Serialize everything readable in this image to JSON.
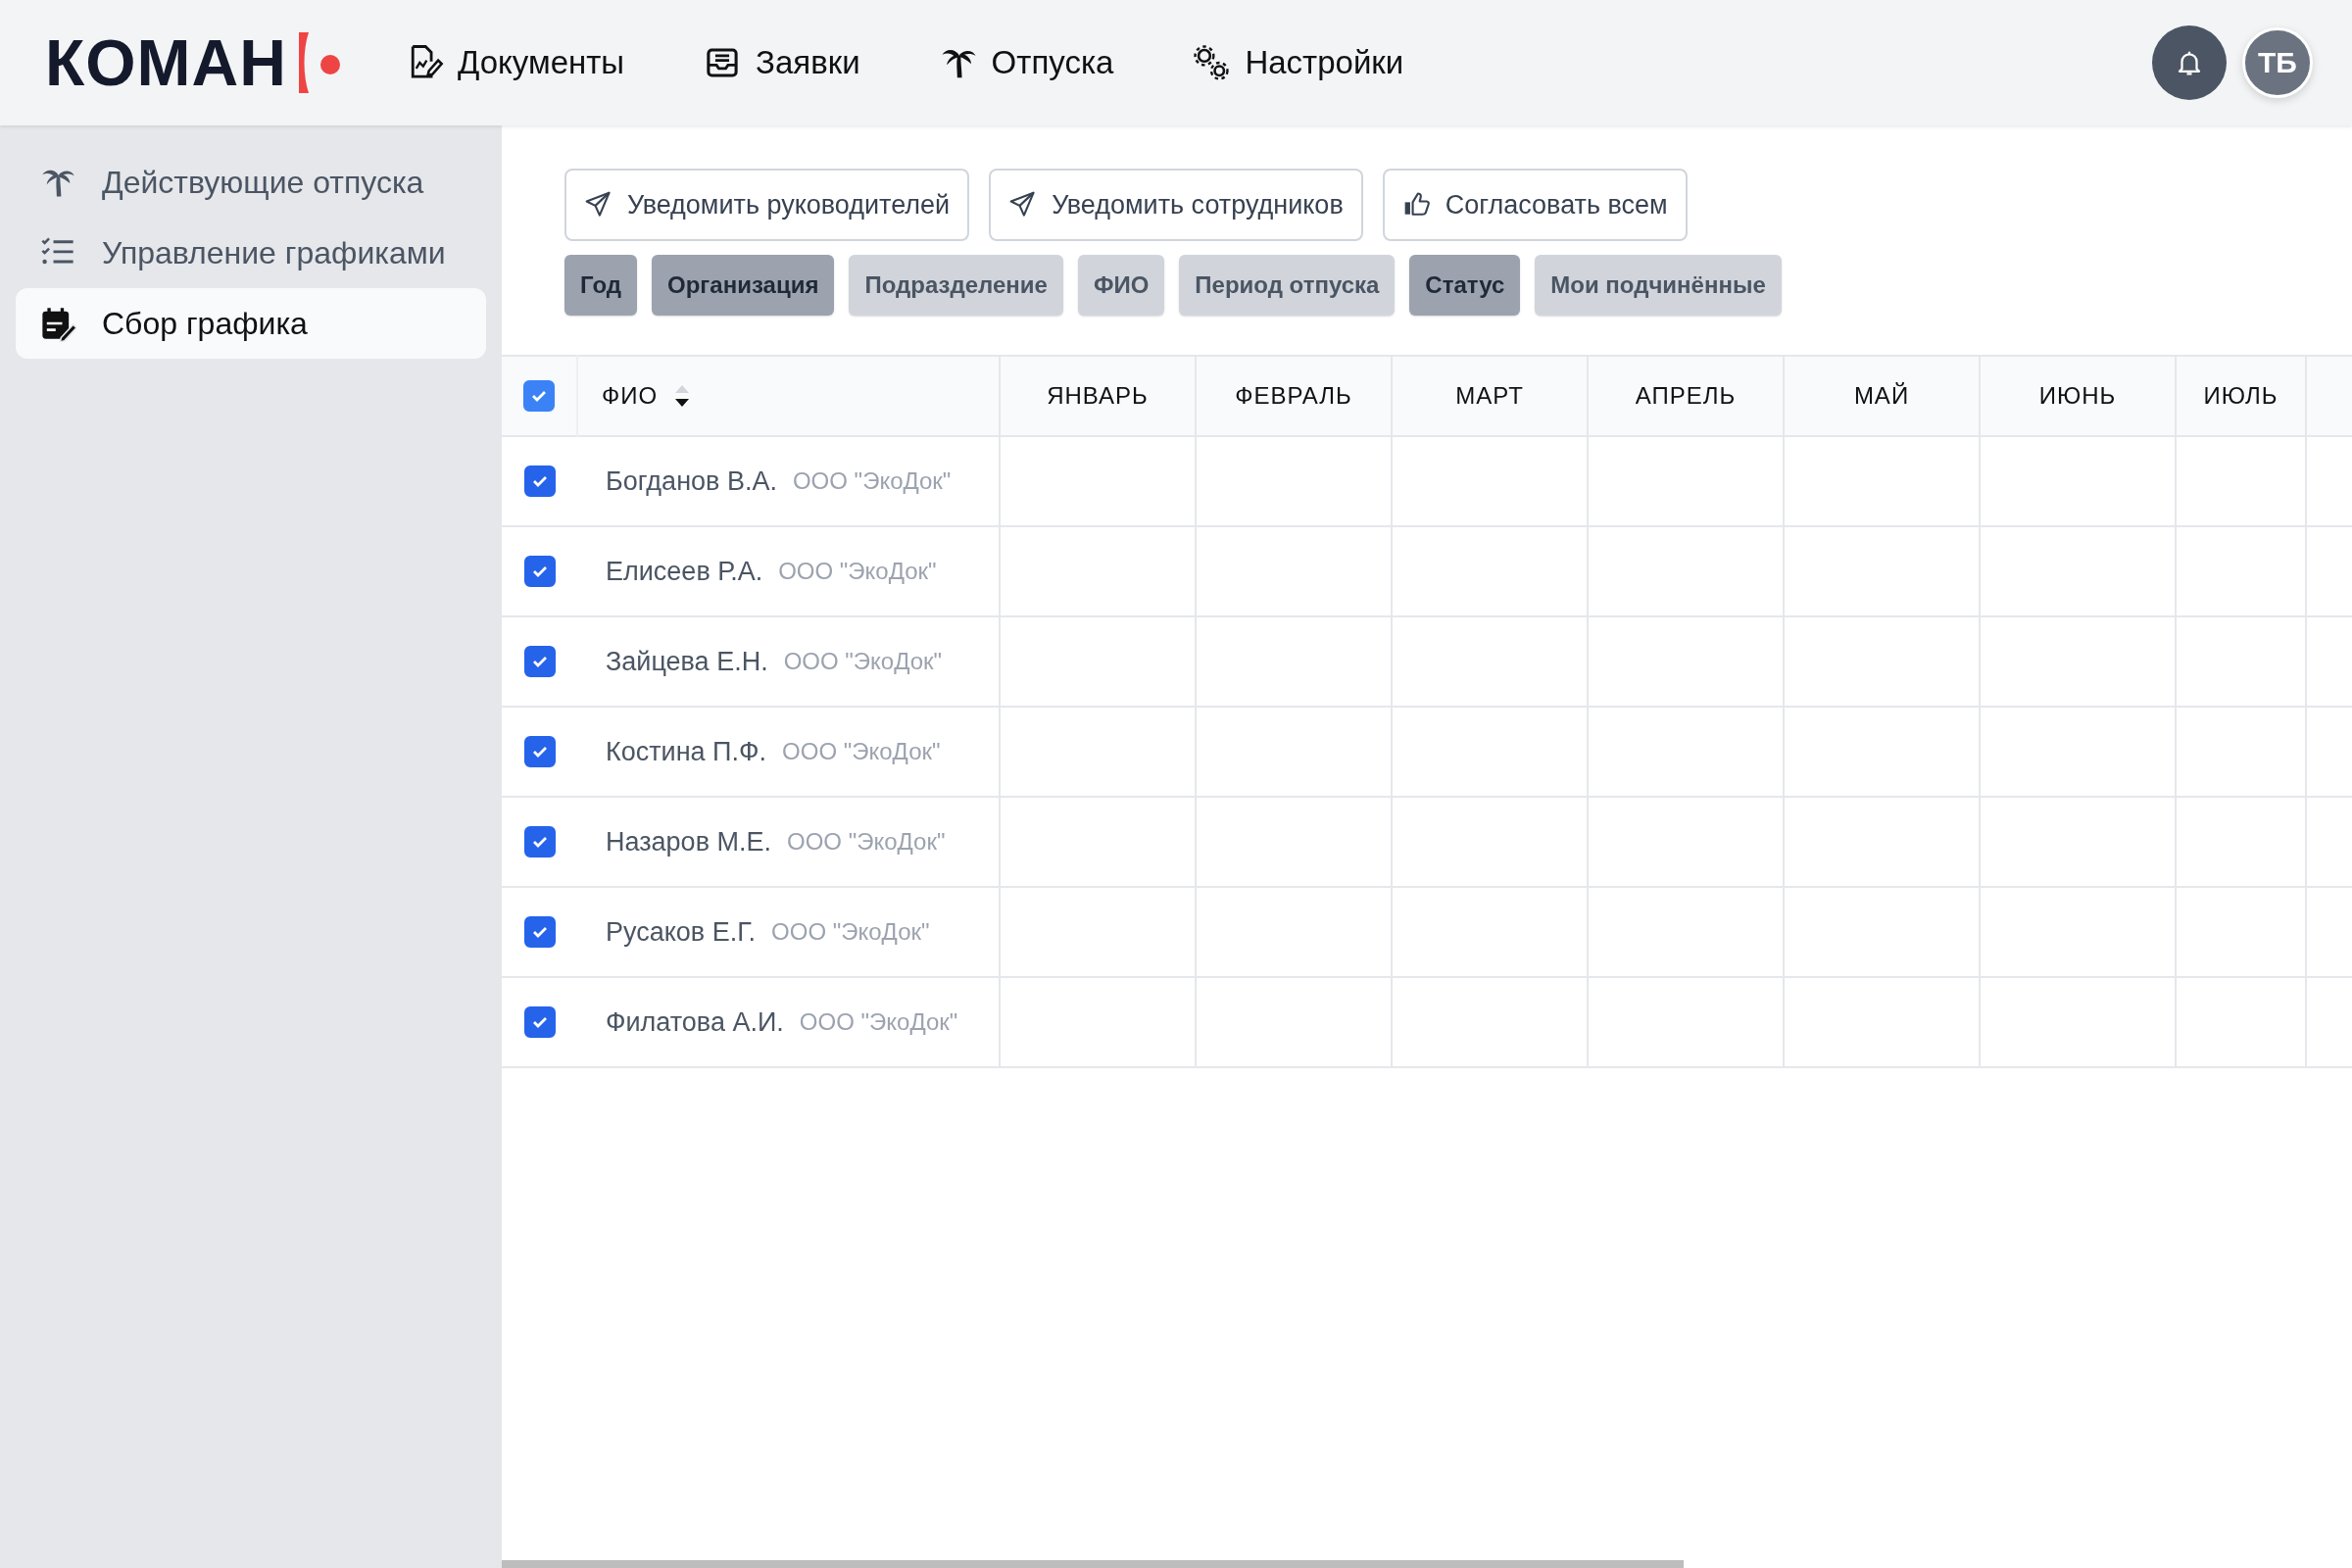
{
  "logo": {
    "text": "КОМАН"
  },
  "nav": [
    {
      "label": "Документы",
      "kind": "document"
    },
    {
      "label": "Заявки",
      "kind": "inbox"
    },
    {
      "label": "Отпуска",
      "kind": "palm"
    },
    {
      "label": "Настройки",
      "kind": "gears"
    }
  ],
  "user": {
    "initials": "ТБ"
  },
  "sidebar": {
    "items": [
      {
        "label": "Действующие отпуска",
        "kind": "palm",
        "selected": false
      },
      {
        "label": "Управление графиками",
        "kind": "checklist",
        "selected": false
      },
      {
        "label": "Сбор графика",
        "kind": "calendar-edit",
        "selected": true
      }
    ]
  },
  "actions": [
    {
      "label": "Уведомить руководителей",
      "kind": "send"
    },
    {
      "label": "Уведомить сотрудников",
      "kind": "send"
    },
    {
      "label": "Согласовать всем",
      "kind": "thumb"
    }
  ],
  "filters": [
    {
      "label": "Год",
      "selected": true
    },
    {
      "label": "Организация",
      "selected": true
    },
    {
      "label": "Подразделение",
      "selected": false
    },
    {
      "label": "ФИО",
      "selected": false
    },
    {
      "label": "Период отпуска",
      "selected": false
    },
    {
      "label": "Статус",
      "selected": true
    },
    {
      "label": "Мои подчинённые",
      "selected": false
    }
  ],
  "table": {
    "select_all": {
      "checked": true
    },
    "name_column": {
      "label": "ФИО"
    },
    "columns": [
      "ЯНВАРЬ",
      "ФЕВРАЛЬ",
      "МАРТ",
      "АПРЕЛЬ",
      "МАЙ",
      "ИЮНЬ",
      "ИЮЛЬ"
    ],
    "rows": [
      {
        "name": "Богданов В.А.",
        "organization": "ООО \"ЭкоДок\"",
        "checked": true
      },
      {
        "name": "Елисеев Р.А.",
        "organization": "ООО \"ЭкоДок\"",
        "checked": true
      },
      {
        "name": "Зайцева Е.Н.",
        "organization": "ООО \"ЭкоДок\"",
        "checked": true
      },
      {
        "name": "Костина П.Ф.",
        "organization": "ООО \"ЭкоДок\"",
        "checked": true
      },
      {
        "name": "Назаров М.Е.",
        "organization": "ООО \"ЭкоДок\"",
        "checked": true
      },
      {
        "name": "Русаков Е.Г.",
        "organization": "ООО \"ЭкоДок\"",
        "checked": true
      },
      {
        "name": "Филатова А.И.",
        "organization": "ООО \"ЭкоДок\"",
        "checked": true
      }
    ]
  }
}
